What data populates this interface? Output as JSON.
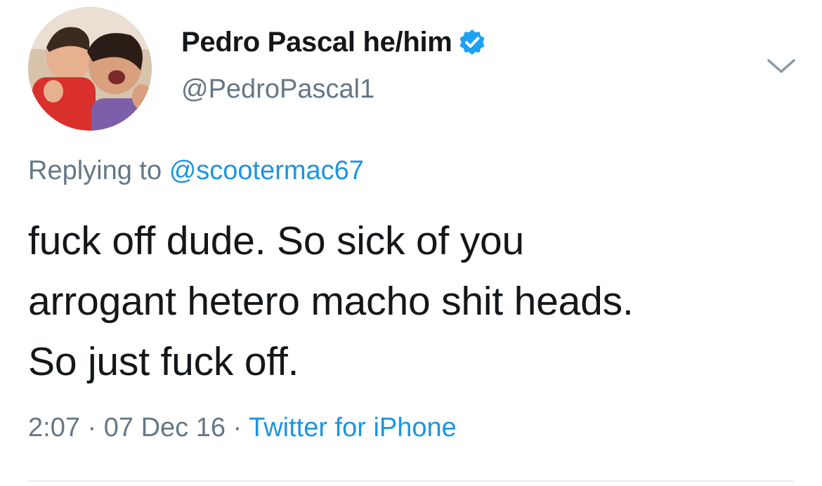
{
  "author": {
    "display_name": "Pedro Pascal he/him",
    "handle": "@PedroPascal1",
    "verified": true,
    "avatar_icon": "profile-photo"
  },
  "reply": {
    "prefix": "Replying to",
    "mention": "@scootermac67"
  },
  "tweet": {
    "lines": [
      "fuck off dude. So sick of you",
      "arrogant hetero macho shit heads.",
      "So just fuck off."
    ]
  },
  "meta": {
    "time": "2:07",
    "separator": "·",
    "date": "07 Dec 16",
    "source": "Twitter for iPhone"
  },
  "colors": {
    "text": "#14171a",
    "secondary": "#657786",
    "accent": "#1b95e0",
    "verified": "#1da1f2"
  },
  "menu_icon": "chevron-down-icon"
}
